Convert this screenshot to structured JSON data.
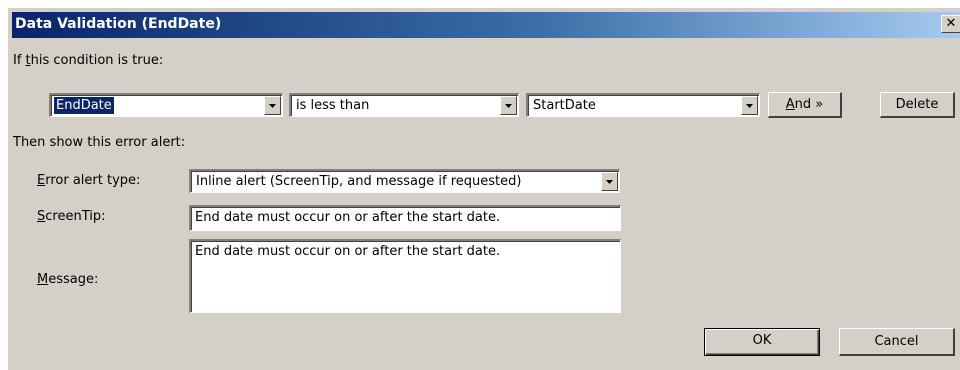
{
  "window": {
    "title": "Data Validation (EndDate)",
    "close_glyph": "✕"
  },
  "condition": {
    "label_pre": "If ",
    "label_accel": "t",
    "label_post": "his condition is true:",
    "field_value": "EndDate",
    "operator_value": "is less than",
    "compare_value": "StartDate",
    "and_button_accel": "A",
    "and_button_rest": "nd »",
    "delete_button": "Delete"
  },
  "alert": {
    "section_label": "Then show this error alert:",
    "type_label_accel": "E",
    "type_label_rest": "rror alert type:",
    "type_value": "Inline alert (ScreenTip, and message if requested)",
    "screentip_label_accel": "S",
    "screentip_label_rest": "creenTip:",
    "screentip_value": "End date must occur on or after the start date.",
    "message_label_accel": "M",
    "message_label_rest": "essage:",
    "message_value": "End date must occur on or after the start date."
  },
  "footer": {
    "ok_button": "OK",
    "cancel_button": "Cancel"
  },
  "colors": {
    "title_gradient_start": "#0a246a",
    "title_gradient_end": "#a6caf0",
    "dialog_face": "#d4d0c8",
    "selection": "#0a246a"
  },
  "icons": {
    "dropdown": "dropdown-arrow-icon",
    "close": "close-icon"
  }
}
